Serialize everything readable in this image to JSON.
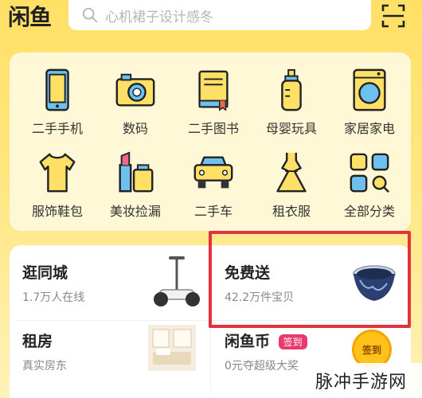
{
  "app": {
    "logo": "闲鱼"
  },
  "search": {
    "placeholder": "心机裙子设计感冬"
  },
  "categories": [
    {
      "label": "二手手机",
      "icon": "phone-icon"
    },
    {
      "label": "数码",
      "icon": "camera-icon"
    },
    {
      "label": "二手图书",
      "icon": "book-icon"
    },
    {
      "label": "母婴玩具",
      "icon": "baby-bottle-icon"
    },
    {
      "label": "家居家电",
      "icon": "washing-machine-icon"
    },
    {
      "label": "服饰鞋包",
      "icon": "tshirt-icon"
    },
    {
      "label": "美妆捡漏",
      "icon": "cosmetics-icon"
    },
    {
      "label": "二手车",
      "icon": "car-icon"
    },
    {
      "label": "租衣服",
      "icon": "dress-icon"
    },
    {
      "label": "全部分类",
      "icon": "all-categories-icon"
    }
  ],
  "cards": {
    "city": {
      "title": "逛同城",
      "subtitle": "1.7万人在线"
    },
    "free": {
      "title": "免费送",
      "subtitle": "42.2万件宝贝"
    },
    "rent": {
      "title": "租房",
      "subtitle": "真实房东"
    },
    "coin": {
      "title": "闲鱼币",
      "badge": "签到",
      "subtitle": "0元夺超级大奖",
      "coin_text": "签到"
    }
  },
  "watermark": "脉冲手游网",
  "colors": {
    "brand_yellow": "#ffe066",
    "highlight_red": "#e2323d",
    "badge_pink": "#e83a6f"
  }
}
